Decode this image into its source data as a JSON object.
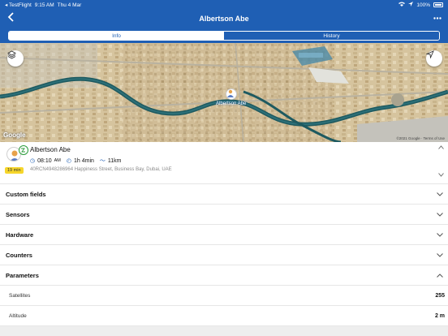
{
  "status_bar": {
    "carrier": "◂ TestFlight",
    "time": "9:15 AM",
    "date": "Thu 4 Mar",
    "battery": "100%"
  },
  "nav": {
    "title": "Albertson Abe",
    "back_icon": "chevron-left-icon",
    "more_icon": "ellipsis-icon"
  },
  "tabs": [
    {
      "label": "Info",
      "active": true
    },
    {
      "label": "History",
      "active": false
    }
  ],
  "map": {
    "attribution": "Google",
    "copyright": "©2021 Google · Terms of Use",
    "marker_label": "Albertson Abe"
  },
  "unit": {
    "name": "Albertson Abe",
    "time": "08:10",
    "time_suffix": "AM",
    "duration": "1h 4min",
    "distance": "11km",
    "address": "40RCN4948286964 Happiness Street, Business Bay, Dubai, UAE",
    "last_update": "19 min"
  },
  "sections": [
    {
      "label": "Custom fields"
    },
    {
      "label": "Sensors"
    },
    {
      "label": "Hardware"
    },
    {
      "label": "Counters"
    },
    {
      "label": "Parameters"
    }
  ],
  "parameters": [
    {
      "key": "Satellites",
      "value": "255"
    },
    {
      "key": "Altitude",
      "value": "2 m"
    }
  ],
  "colors": {
    "primary": "#1f5fb4",
    "accent_yellow": "#f6d62b",
    "online_green": "#2a9b3a"
  }
}
